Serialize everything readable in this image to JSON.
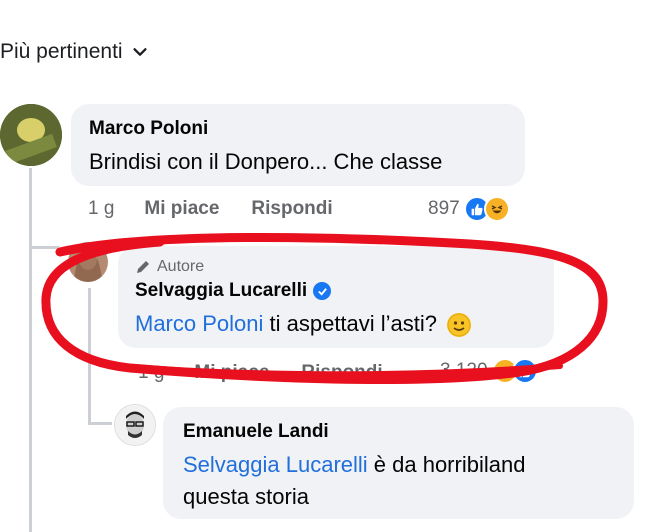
{
  "sort": {
    "label": "Più pertinenti"
  },
  "comments": [
    {
      "author": "Marco Poloni",
      "text": "Brindisi con il Donpero... Che classe",
      "time": "1 g",
      "like": "Mi piace",
      "reply": "Rispondi",
      "reactions": "897"
    },
    {
      "badge": "Autore",
      "author": "Selvaggia Lucarelli",
      "mention": "Marco Poloni",
      "text": " ti aspettavi l’asti?",
      "time": "1 g",
      "like": "Mi piace",
      "reply": "Rispondi",
      "reactions": "3.120"
    },
    {
      "author": "Emanuele Landi",
      "mention": "Selvaggia Lucarelli",
      "text_line1": " è da horribiland",
      "text_line2": "questa storia"
    }
  ],
  "colors": {
    "annotation": "#e8101e",
    "accent": "#1877f2",
    "mention": "#216fdb"
  }
}
